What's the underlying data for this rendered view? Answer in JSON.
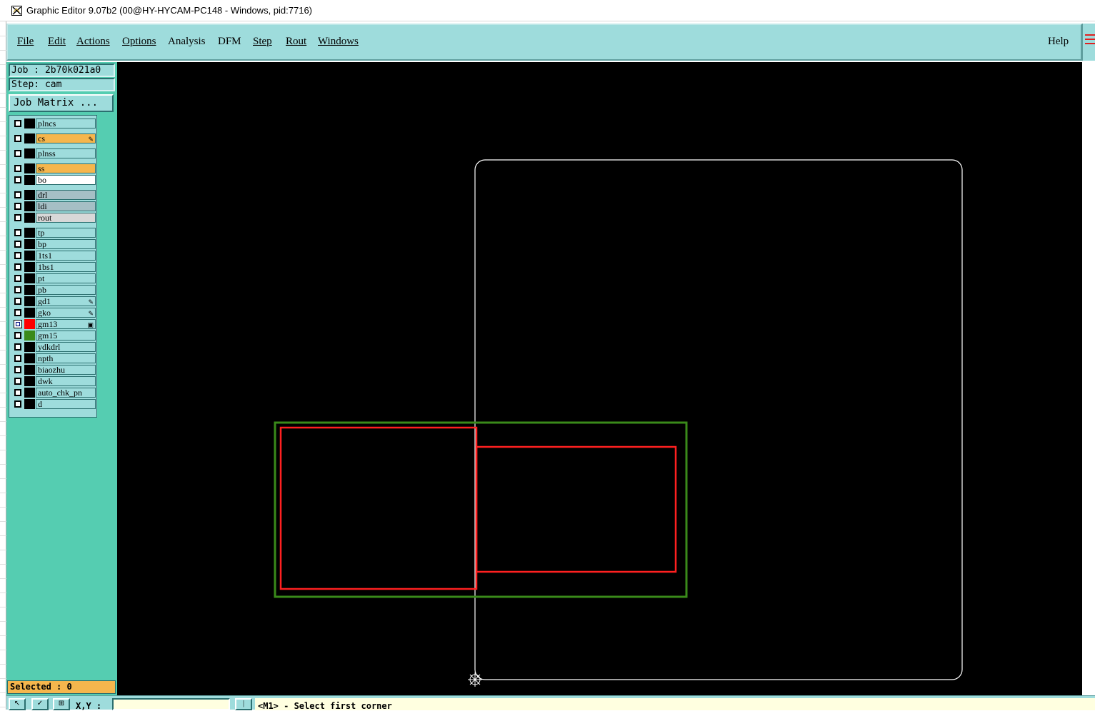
{
  "window": {
    "title": "Graphic Editor 9.07b2 (00@HY-HYCAM-PC148 - Windows, pid:7716)"
  },
  "menu": {
    "items": [
      "File",
      "Edit",
      "Actions",
      "Options",
      "Analysis",
      "DFM",
      "Step",
      "Rout",
      "Windows"
    ],
    "help": "Help"
  },
  "job": {
    "job_label": "Job : 2b70k021a0",
    "step_label": "Step: cam",
    "matrix_button": "Job Matrix ..."
  },
  "layers": [
    {
      "name": "plncs",
      "fill": "#9edcdc",
      "checked": false,
      "marker": ""
    },
    {
      "name": "cs",
      "fill": "#f5b64d",
      "checked": false,
      "marker": "pen"
    },
    {
      "name": "plnss",
      "fill": "#9edcdc",
      "checked": false,
      "marker": ""
    },
    {
      "name": "ss",
      "fill": "#f5b64d",
      "checked": false,
      "marker": ""
    },
    {
      "name": "bo",
      "fill": "#ffffff",
      "checked": false,
      "marker": ""
    },
    {
      "name": "drl",
      "fill": "#a5bfc5",
      "checked": false,
      "marker": ""
    },
    {
      "name": "ldi",
      "fill": "#a5bfc5",
      "checked": false,
      "marker": ""
    },
    {
      "name": "rout",
      "fill": "#d8d8d8",
      "checked": false,
      "marker": ""
    },
    {
      "name": "tp",
      "fill": "#9edcdc",
      "checked": false,
      "marker": ""
    },
    {
      "name": "bp",
      "fill": "#9edcdc",
      "checked": false,
      "marker": ""
    },
    {
      "name": "1ts1",
      "fill": "#9edcdc",
      "checked": false,
      "marker": ""
    },
    {
      "name": "1bs1",
      "fill": "#9edcdc",
      "checked": false,
      "marker": ""
    },
    {
      "name": "pt",
      "fill": "#9edcdc",
      "checked": false,
      "marker": ""
    },
    {
      "name": "pb",
      "fill": "#9edcdc",
      "checked": false,
      "marker": ""
    },
    {
      "name": "gd1",
      "fill": "#9edcdc",
      "checked": false,
      "marker": "pen"
    },
    {
      "name": "gko",
      "fill": "#9edcdc",
      "checked": false,
      "marker": "pen"
    },
    {
      "name": "gm13",
      "fill": "#9edcdc",
      "checked": true,
      "swatch": "#ff0000",
      "marker": "box"
    },
    {
      "name": "gm15",
      "fill": "#9edcdc",
      "checked": false,
      "swatch": "#3a8a1a",
      "marker": ""
    },
    {
      "name": "ydkdrl",
      "fill": "#9edcdc",
      "checked": false,
      "marker": ""
    },
    {
      "name": "npth",
      "fill": "#9edcdc",
      "checked": false,
      "marker": ""
    },
    {
      "name": "biaozhu",
      "fill": "#9edcdc",
      "checked": false,
      "marker": ""
    },
    {
      "name": "dwk",
      "fill": "#9edcdc",
      "checked": false,
      "marker": ""
    },
    {
      "name": "auto_chk_pn",
      "fill": "#9edcdc",
      "checked": false,
      "marker": ""
    },
    {
      "name": "d",
      "fill": "#9edcdc",
      "checked": false,
      "marker": ""
    }
  ],
  "status": {
    "selected": "Selected : 0",
    "xy_label": "X,Y :",
    "message": "<M1> - Select first corner"
  },
  "colors": {
    "profile": "#ffffff",
    "gm13": "#ff2020",
    "gm15": "#3a8a1a",
    "panel": "#55cdb1",
    "menubar": "#9edcdc"
  }
}
